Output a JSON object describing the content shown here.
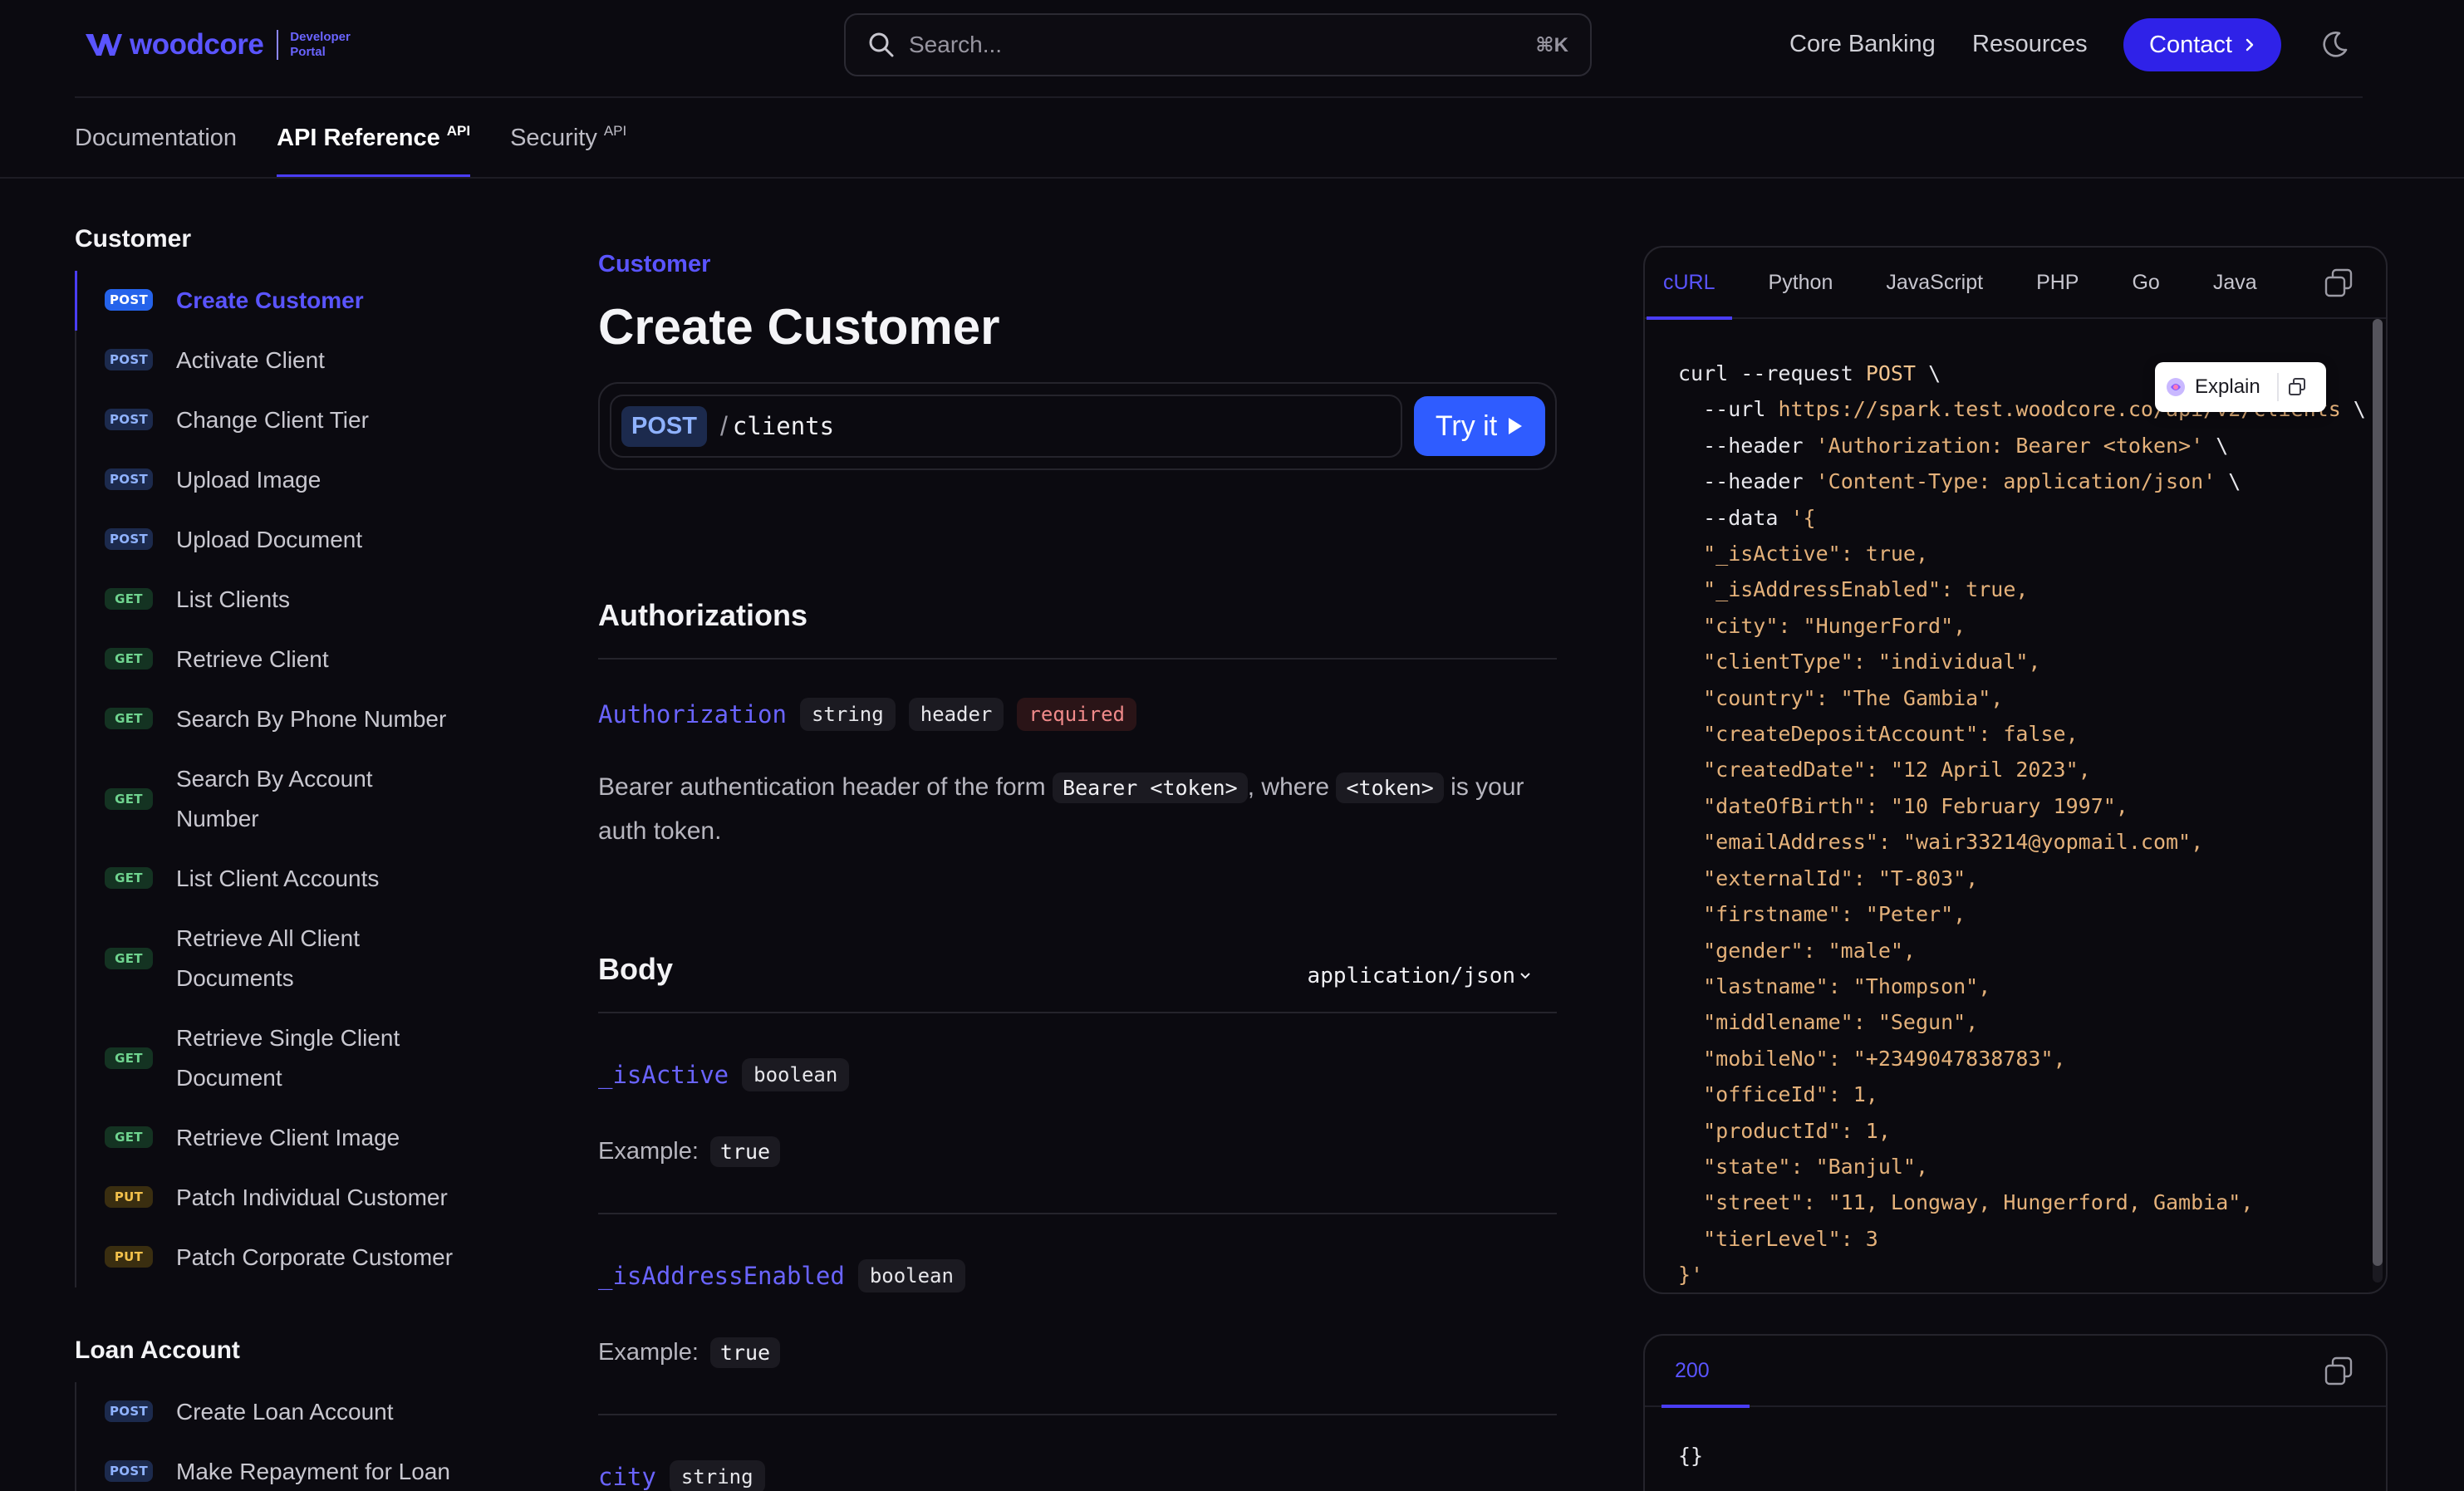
{
  "header": {
    "logo_text": "woodcore",
    "logo_sub_line1": "Developer",
    "logo_sub_line2": "Portal",
    "search_placeholder": "Search...",
    "search_shortcut": "⌘K",
    "nav": [
      "Core Banking",
      "Resources"
    ],
    "contact_label": "Contact",
    "accent_color": "#2f22e8"
  },
  "tabs": [
    {
      "label": "Documentation",
      "sup": ""
    },
    {
      "label": "API Reference",
      "sup": "API"
    },
    {
      "label": "Security",
      "sup": "API"
    }
  ],
  "sidebar": {
    "groups": [
      {
        "title": "Customer",
        "items": [
          {
            "method": "POST",
            "label": "Create Customer"
          },
          {
            "method": "POST",
            "label": "Activate Client"
          },
          {
            "method": "POST",
            "label": "Change Client Tier"
          },
          {
            "method": "POST",
            "label": "Upload Image"
          },
          {
            "method": "POST",
            "label": "Upload Document"
          },
          {
            "method": "GET",
            "label": "List Clients"
          },
          {
            "method": "GET",
            "label": "Retrieve Client"
          },
          {
            "method": "GET",
            "label": "Search By Phone Number"
          },
          {
            "method": "GET",
            "label": "Search By Account Number"
          },
          {
            "method": "GET",
            "label": "List Client Accounts"
          },
          {
            "method": "GET",
            "label": "Retrieve All Client Documents"
          },
          {
            "method": "GET",
            "label": "Retrieve Single Client Document"
          },
          {
            "method": "GET",
            "label": "Retrieve Client Image"
          },
          {
            "method": "PUT",
            "label": "Patch Individual Customer"
          },
          {
            "method": "PUT",
            "label": "Patch Corporate Customer"
          }
        ]
      },
      {
        "title": "Loan Account",
        "items": [
          {
            "method": "POST",
            "label": "Create Loan Account"
          },
          {
            "method": "POST",
            "label": "Make Repayment for Loan"
          }
        ]
      }
    ]
  },
  "main": {
    "eyebrow": "Customer",
    "title": "Create Customer",
    "endpoint": {
      "method": "POST",
      "slash": "/",
      "path": "clients",
      "try_label": "Try it"
    },
    "authorizations": {
      "title": "Authorizations",
      "param": {
        "name": "Authorization",
        "type": "string",
        "location": "header",
        "required": "required"
      },
      "desc_part1": "Bearer authentication header of the form",
      "desc_code1": "Bearer <token>",
      "desc_part2": ", where",
      "desc_code2": "<token>",
      "desc_part3": "is your",
      "desc_part4": "auth token."
    },
    "body": {
      "title": "Body",
      "content_type": "application/json",
      "params": [
        {
          "name": "_isActive",
          "type": "boolean",
          "example_label": "Example:",
          "example": "true"
        },
        {
          "name": "_isAddressEnabled",
          "type": "boolean",
          "example_label": "Example:",
          "example": "true"
        },
        {
          "name": "city",
          "type": "string"
        }
      ]
    }
  },
  "code_panel": {
    "tabs": [
      "cURL",
      "Python",
      "JavaScript",
      "PHP",
      "Go",
      "Java"
    ],
    "explain_label": "Explain",
    "curl": {
      "cmd": "curl",
      "request_flag": "--request",
      "method": "POST",
      "url_flag": "--url",
      "url": "https://spark.test.woodcore.co/api/v2/clients",
      "header_flag": "--header",
      "auth_header": "'Authorization: Bearer <token>'",
      "ct_header": "'Content-Type: application/json'",
      "data_flag": "--data",
      "data_open": "'{",
      "data_close": "}'"
    },
    "body_lines": [
      "\"_isActive\": true,",
      "\"_isAddressEnabled\": true,",
      "\"city\": \"HungerFord\",",
      "\"clientType\": \"individual\",",
      "\"country\": \"The Gambia\",",
      "\"createDepositAccount\": false,",
      "\"createdDate\": \"12 April 2023\",",
      "\"dateOfBirth\": \"10 February 1997\",",
      "\"emailAddress\": \"wair33214@yopmail.com\",",
      "\"externalId\": \"T-803\",",
      "\"firstname\": \"Peter\",",
      "\"gender\": \"male\",",
      "\"lastname\": \"Thompson\",",
      "\"middlename\": \"Segun\",",
      "\"mobileNo\": \"+2349047838783\",",
      "\"officeId\": 1,",
      "\"productId\": 1,",
      "\"state\": \"Banjul\",",
      "\"street\": \"11, Longway, Hungerford, Gambia\",",
      "\"tierLevel\": 3"
    ]
  },
  "response_panel": {
    "tab": "200",
    "body": "{}"
  }
}
